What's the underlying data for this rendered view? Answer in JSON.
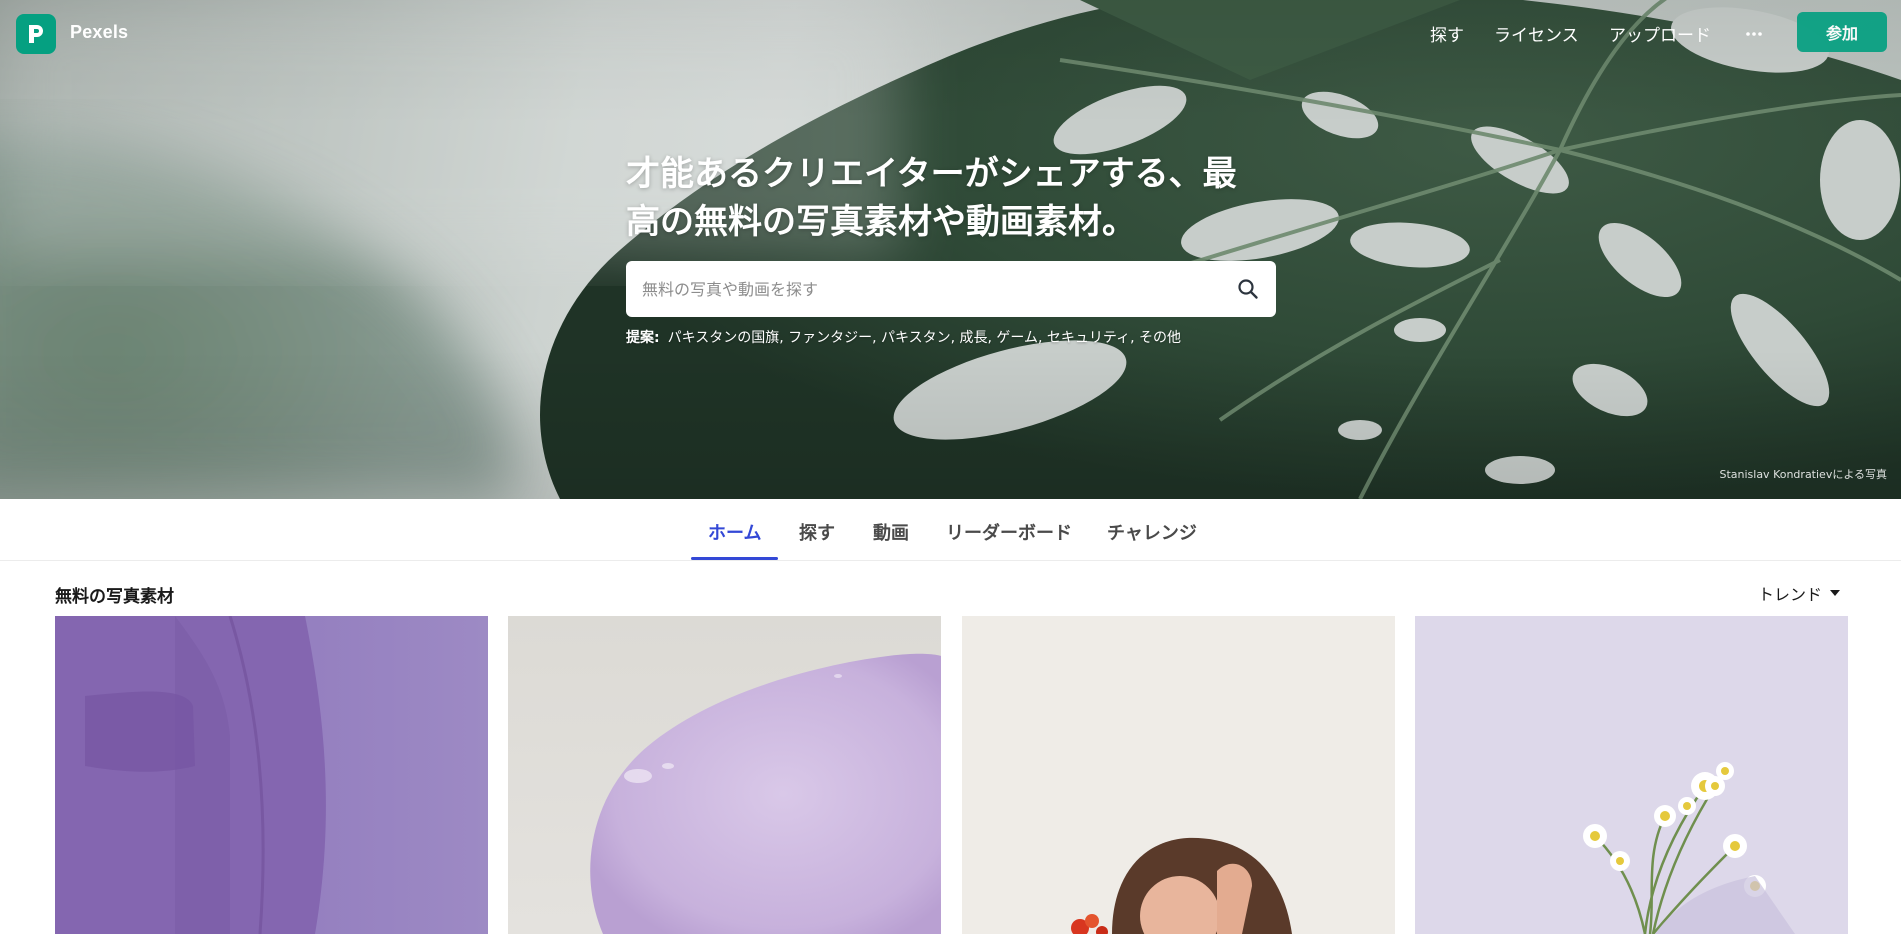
{
  "brand": {
    "name": "Pexels",
    "logo_letter": "P",
    "color": "#05a081"
  },
  "topnav": {
    "items": [
      "探す",
      "ライセンス",
      "アップロード"
    ],
    "more_icon": "ellipsis-icon",
    "join_label": "参加"
  },
  "hero": {
    "headline_line1": "才能あるクリエイターがシェアする、最",
    "headline_line2": "高の無料の写真素材や動画素材。",
    "search": {
      "placeholder": "無料の写真や動画を探す",
      "value": ""
    },
    "suggestions_label": "提案:",
    "suggestions": [
      "パキスタンの国旗",
      "ファンタジー",
      "パキスタン",
      "成長",
      "ゲーム",
      "セキュリティ",
      "その他"
    ],
    "credit": "Stanislav Kondratievによる写真"
  },
  "tabs": [
    {
      "label": "ホーム",
      "active": true
    },
    {
      "label": "探す",
      "active": false
    },
    {
      "label": "動画",
      "active": false
    },
    {
      "label": "リーダーボード",
      "active": false
    },
    {
      "label": "チャレンジ",
      "active": false
    }
  ],
  "section": {
    "title": "無料の写真素材",
    "sort_label": "トレンド"
  },
  "colors": {
    "accent": "#3348d6",
    "join_button": "#05a081"
  }
}
